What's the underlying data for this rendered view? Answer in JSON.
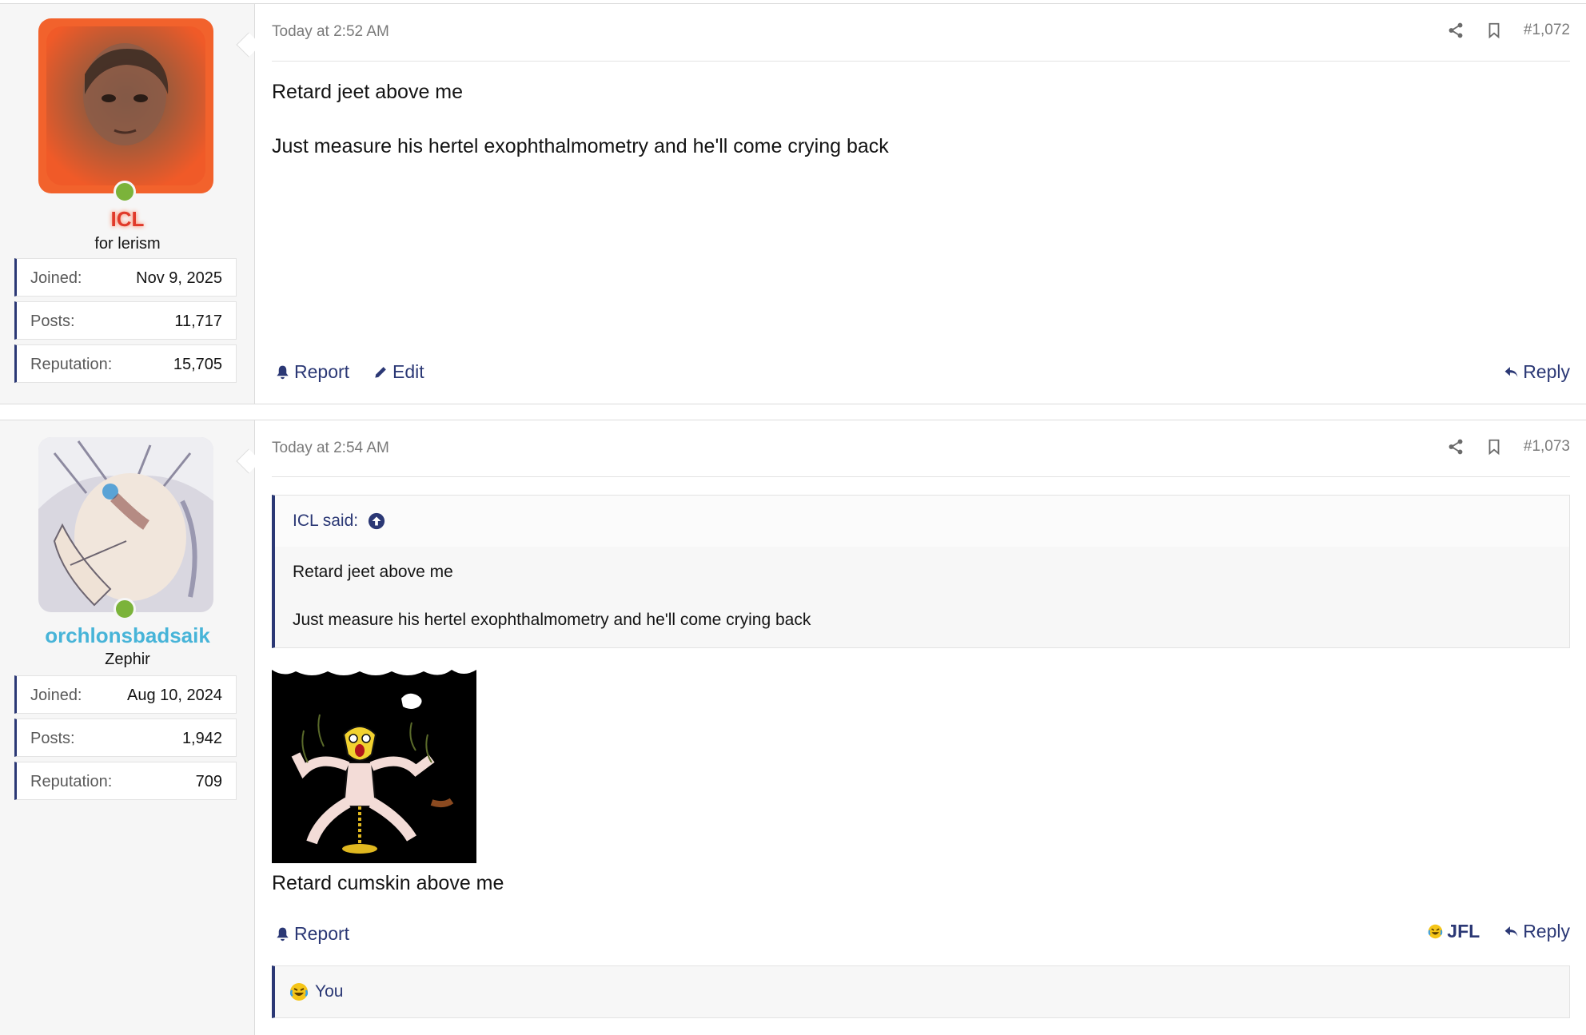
{
  "posts": [
    {
      "user": {
        "name": "ICL",
        "name_color": "#e03a2a",
        "title": "for lerism",
        "stats": [
          {
            "k": "Joined:",
            "v": "Nov 9, 2025"
          },
          {
            "k": "Posts:",
            "v": "11,717"
          },
          {
            "k": "Reputation:",
            "v": "15,705"
          }
        ]
      },
      "date": "Today at 2:52 AM",
      "number": "#1,072",
      "lines": [
        "Retard jeet above me",
        "Just measure his hertel exophthalmometry and he'll come crying back"
      ],
      "actions": {
        "report": "Report",
        "edit": "Edit",
        "reply": "Reply"
      }
    },
    {
      "user": {
        "name": "orchlonsbadsaik",
        "name_color": "#47b4d8",
        "title": "Zephir",
        "stats": [
          {
            "k": "Joined:",
            "v": "Aug 10, 2024"
          },
          {
            "k": "Posts:",
            "v": "1,942"
          },
          {
            "k": "Reputation:",
            "v": "709"
          }
        ]
      },
      "date": "Today at 2:54 AM",
      "number": "#1,073",
      "quote": {
        "author": "ICL said:",
        "lines": [
          "Retard jeet above me",
          "Just measure his hertel exophthalmometry and he'll come crying back"
        ]
      },
      "text": "Retard cumskin above me",
      "actions": {
        "report": "Report",
        "jfl": "JFL",
        "reply": "Reply"
      },
      "reactions": "You"
    }
  ],
  "colors": {
    "accent": "#2b3875",
    "online": "#7bb33a"
  }
}
